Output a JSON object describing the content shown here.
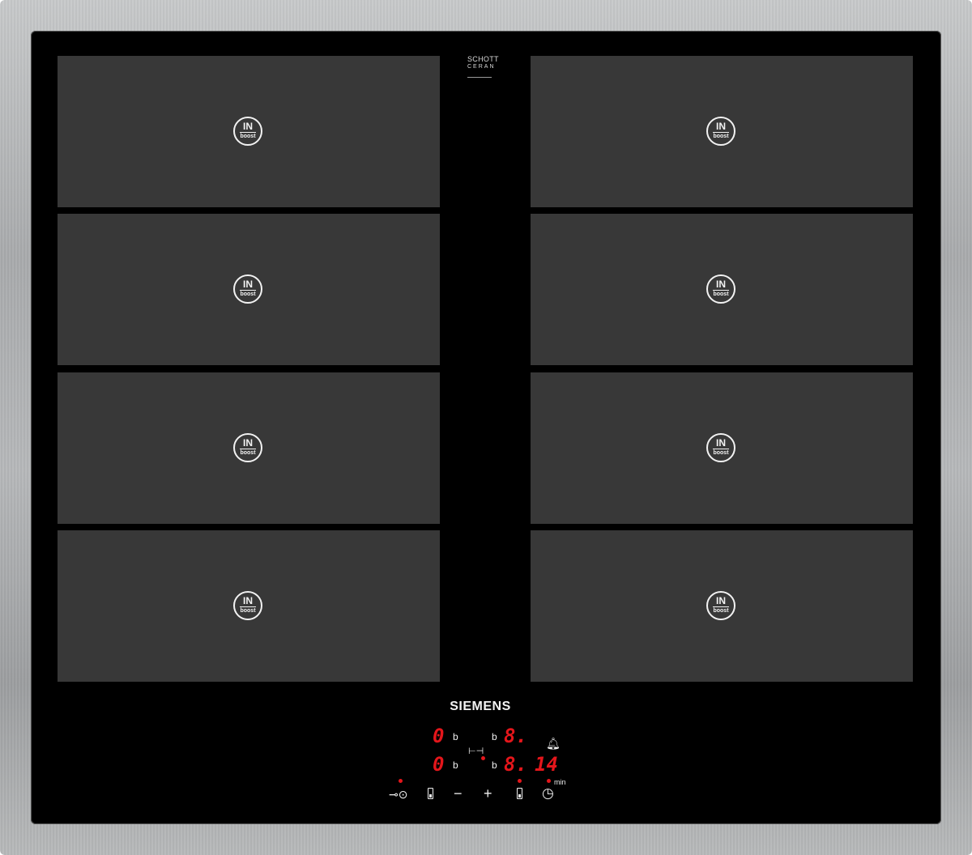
{
  "brand": "SIEMENS",
  "glass_brand": {
    "line1": "SCHOTT",
    "line2": "CERAN"
  },
  "zone_badge": {
    "top": "IN",
    "bottom": "boost"
  },
  "zones": [
    {
      "id": "left-1"
    },
    {
      "id": "right-1"
    },
    {
      "id": "left-2"
    },
    {
      "id": "right-2"
    },
    {
      "id": "left-3"
    },
    {
      "id": "right-3"
    },
    {
      "id": "left-4"
    },
    {
      "id": "right-4"
    }
  ],
  "display": {
    "row1": {
      "left_level": "0",
      "left_flag": "b",
      "right_flag": "b",
      "right_level": "8."
    },
    "row2": {
      "left_level": "0",
      "left_flag": "b",
      "right_flag": "b",
      "right_level": "8.",
      "timer_value": "14"
    },
    "timer_unit": "min",
    "link_symbol": "⊢⊣"
  },
  "controls": {
    "key_lock": "⊸⊙",
    "minus": "−",
    "plus": "+",
    "alarm_icon": "🔔︎",
    "clock_icon": "◷"
  },
  "colors": {
    "glass": "#000000",
    "zone": "#383838",
    "led": "#e4161b",
    "frame": "#b0b2b4"
  }
}
